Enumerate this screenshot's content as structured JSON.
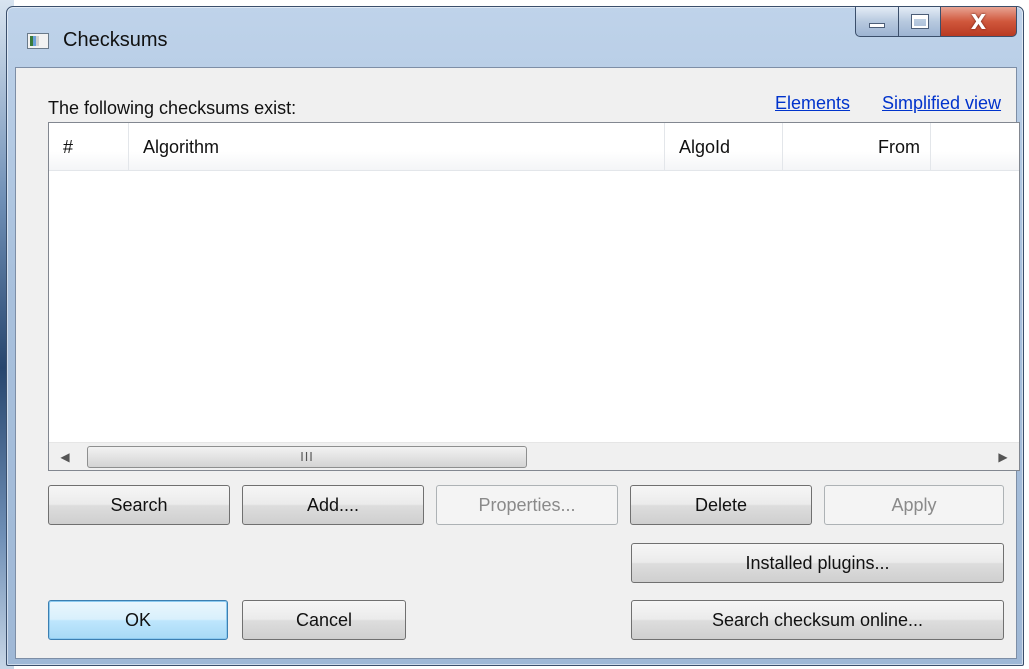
{
  "window": {
    "title": "Checksums"
  },
  "caption_buttons": {
    "close_glyph": "X"
  },
  "header_text": "The following checksums exist:",
  "links": {
    "elements": "Elements",
    "simplified_view": "Simplified view"
  },
  "list": {
    "columns": [
      "#",
      "Algorithm",
      "AlgoId",
      "From",
      ""
    ],
    "rows": []
  },
  "scrollbar": {
    "left_arrow": "◀",
    "right_arrow": "▶",
    "grip": "III"
  },
  "buttons": {
    "search": "Search",
    "add": "Add....",
    "properties": "Properties...",
    "delete": "Delete",
    "apply": "Apply",
    "installed_plugins": "Installed plugins...",
    "ok": "OK",
    "cancel": "Cancel",
    "search_online": "Search checksum online..."
  }
}
